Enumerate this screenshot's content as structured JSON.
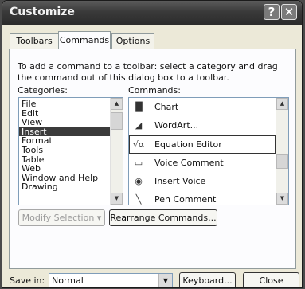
{
  "window": {
    "title": "Customize",
    "help_glyph": "?",
    "close_glyph": "✕"
  },
  "tabs": [
    {
      "label": "Toolbars"
    },
    {
      "label": "Commands"
    },
    {
      "label": "Options"
    }
  ],
  "instructions": "To add a command to a toolbar: select a category and drag the command out of this dialog box to a toolbar.",
  "categories": {
    "label": "Categories:",
    "items": [
      "File",
      "Edit",
      "View",
      "Insert",
      "Format",
      "Tools",
      "Table",
      "Web",
      "Window and Help",
      "Drawing"
    ],
    "selected": "Insert"
  },
  "commands": {
    "label": "Commands:",
    "items": [
      {
        "label": "Chart",
        "icon": "chart-icon",
        "glyph": "▐▌"
      },
      {
        "label": "WordArt...",
        "icon": "wordart-icon",
        "glyph": "◢"
      },
      {
        "label": "Equation Editor",
        "icon": "equation-icon",
        "glyph": "√α"
      },
      {
        "label": "Voice Comment",
        "icon": "voice-comment-icon",
        "glyph": "▭"
      },
      {
        "label": "Insert Voice",
        "icon": "insert-voice-icon",
        "glyph": "◉"
      },
      {
        "label": "Pen Comment",
        "icon": "pen-comment-icon",
        "glyph": "╲"
      }
    ],
    "selected": "Equation Editor"
  },
  "buttons": {
    "modify_selection": "Modify Selection",
    "modify_arrow": "▾",
    "rearrange": "Rearrange Commands...",
    "keyboard": "Keyboard...",
    "close": "Close"
  },
  "save_in": {
    "label": "Save in:",
    "value": "Normal"
  }
}
